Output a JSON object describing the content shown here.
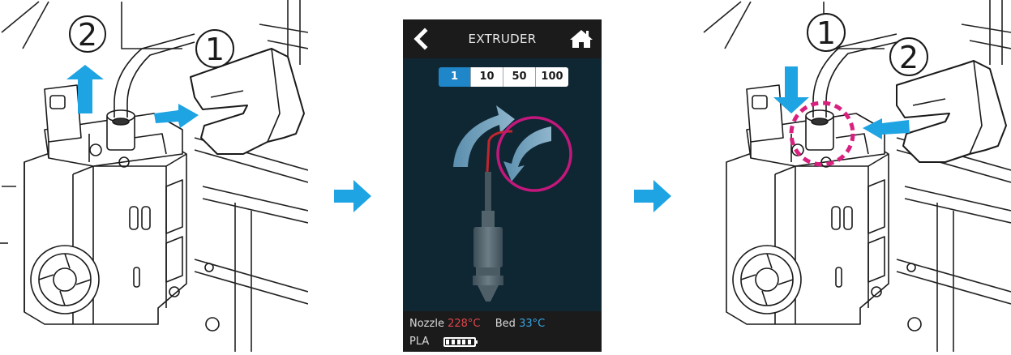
{
  "screen": {
    "title": "EXTRUDER",
    "back_icon": "chevron-left-icon",
    "home_icon": "home-icon",
    "step_options": [
      "1",
      "10",
      "50",
      "100"
    ],
    "selected_step": "1",
    "status": {
      "nozzle_label": "Nozzle",
      "nozzle_temp": "228°C",
      "bed_label": "Bed",
      "bed_temp": "33°C",
      "material": "PLA",
      "filament_level": 1.0
    },
    "colors": {
      "background": "#0f2633",
      "bars": "#1b1b1b",
      "accent": "#1f87c9",
      "highlight_ring": "#c2187b",
      "nozzle_temp": "#e0454b",
      "bed_temp": "#37a6e6"
    }
  },
  "left_illustration": {
    "callouts": [
      "②",
      "①"
    ],
    "description_icons": [
      "up-arrow-icon",
      "right-arrow-icon",
      "lever-icon"
    ]
  },
  "right_illustration": {
    "callouts": [
      "①",
      "②"
    ],
    "description_icons": [
      "down-arrow-icon",
      "left-arrow-icon",
      "lever-icon",
      "dashed-circle-highlight"
    ]
  },
  "flow_arrow_color": "#1ea3e3"
}
